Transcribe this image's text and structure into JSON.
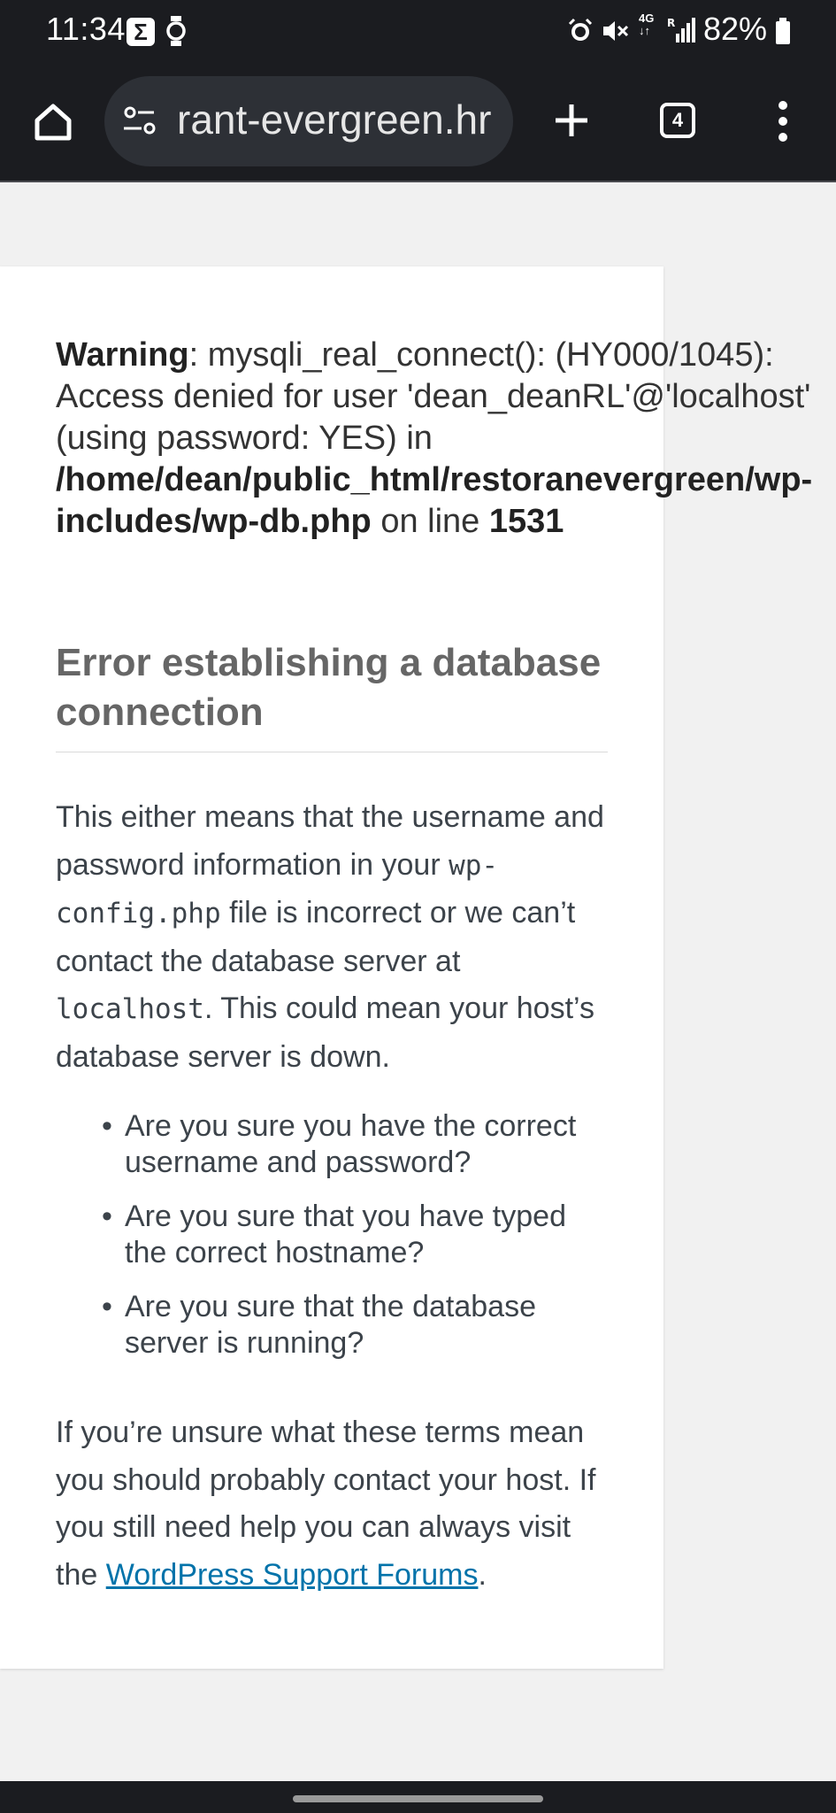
{
  "status_bar": {
    "time": "11:34",
    "sigma_label": "Σ",
    "network_type_top": "4G",
    "network_type_side": "R",
    "battery_percent": "82%"
  },
  "browser": {
    "url_text": "rant-evergreen.hr",
    "tab_count": "4"
  },
  "warning": {
    "label": "Warning",
    "message": ": mysqli_real_connect(): (HY000/1045): Access denied for user 'dean_deanRL'@'localhost' (using password: YES) in ",
    "path": "/home/dean/public_html/restoranevergreen/wp-includes/wp-db.php",
    "on_line": " on line ",
    "line_number": "1531"
  },
  "error": {
    "heading": "Error establishing a database connection",
    "intro_part1": "This either means that the username and password information in your ",
    "config_file": "wp-config.php",
    "intro_part2": " file is incorrect or we can’t contact the database server at ",
    "host": "localhost",
    "intro_part3": ". This could mean your host’s database server is down.",
    "tips": [
      "Are you sure you have the correct username and password?",
      "Are you sure that you have typed the correct hostname?",
      "Are you sure that the database server is running?"
    ],
    "outro": "If you’re unsure what these terms mean you should probably contact your host. If you still need help you can always visit the ",
    "support_link_text": "WordPress Support Forums",
    "outro_end": "."
  },
  "colors": {
    "chrome_background": "#1b1c20",
    "page_background": "#f1f1f1",
    "link": "#0073aa"
  },
  "icons": [
    "home-icon",
    "site-info-icon",
    "plus-icon",
    "tabs-icon",
    "more-vert-icon",
    "alarm-icon",
    "mute-icon",
    "signal-icon",
    "battery-icon",
    "watch-icon"
  ]
}
